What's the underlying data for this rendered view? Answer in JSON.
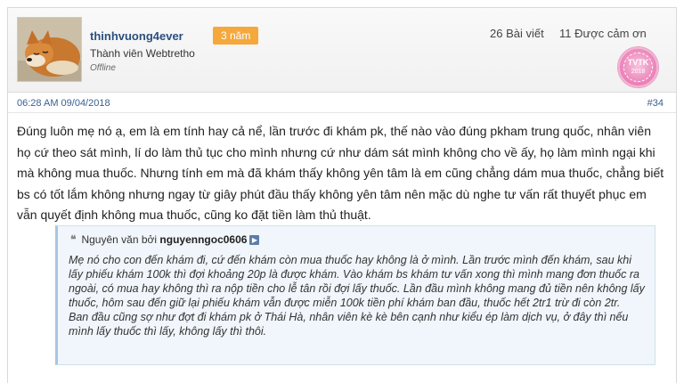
{
  "author": {
    "username": "thinhvuong4ever",
    "years_badge": "3 năm",
    "rank": "Thành viên Webtretho",
    "status": "Offline",
    "avatar_icon": "dog-avatar"
  },
  "stats": {
    "posts": "26 Bài viết",
    "thanks": "11 Được cảm ơn"
  },
  "badge": {
    "line1": "TVTK",
    "line2": "2018",
    "color": "#ea7fb6"
  },
  "post_meta": {
    "datetime": "06:28 AM 09/04/2018",
    "post_number": "#34"
  },
  "body": "Đúng luôn mẹ nó ạ, em là em tính hay cả nể, lần trước đi khám pk, thế nào vào đúng pkham trung quốc, nhân viên họ cứ theo sát mình, lí do làm thủ tục cho mình nhưng cứ như dám sát mình không cho về ấy, họ làm mình ngại khi mà không mua thuốc. Nhưng tính em mà đã khám thấy không yên tâm là em cũng chẳng dám mua thuốc, chẳng biết bs có tốt lắm không nhưng ngay từ giây phút đầu thấy không yên tâm nên mặc dù nghe tư vấn rất thuyết phục em vẫn quyết định không mua thuốc, cũng ko đặt tiền làm thủ thuật.",
  "quote": {
    "prefix": "Nguyên văn bởi",
    "author": "nguyenngoc0606",
    "line1": "Mẹ nó cho con đến khám đi, cứ đến khám còn mua thuốc hay không là ở mình. Lần trước mình đến khám, sau khi lấy phiếu khám 100k thì đợi khoảng 20p là được khám. Vào khám bs khám tư vấn xong thì mình mang đơn thuốc ra ngoài, có mua hay không thì ra nộp tiền cho lễ tân rồi đợi lấy thuốc. Lần đầu mình không mang đủ tiền nên không lấy thuốc, hôm sau đến giữ lại phiếu khám vẫn được miễn 100k tiền phí khám ban đầu, thuốc hết 2tr1 trừ đi còn 2tr.",
    "line2": "Ban đầu cũng sợ như đợt đi khám pk ở Thái Hà, nhân viên kè kè bên cạnh như kiểu ép làm dịch vụ, ở đây thì nếu mình lấy thuốc thì lấy, không lấy thì thôi."
  }
}
